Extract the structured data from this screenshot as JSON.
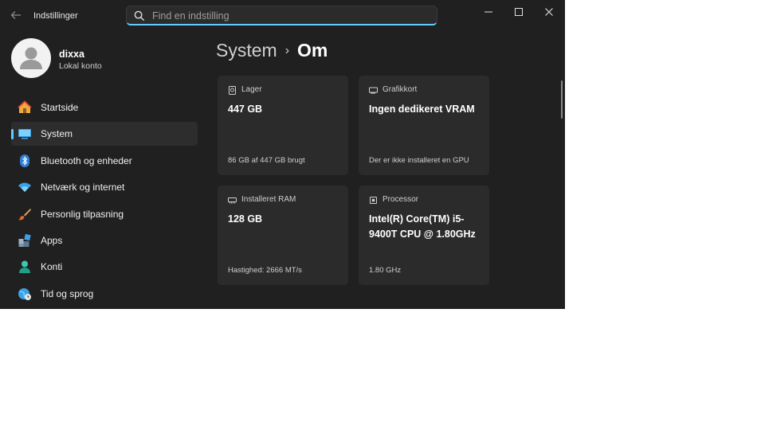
{
  "window": {
    "title": "Indstillinger",
    "search": {
      "placeholder": "Find en indstilling",
      "value": ""
    },
    "controls": {
      "minimize": "minimize",
      "maximize": "maximize",
      "close": "close"
    }
  },
  "profile": {
    "name": "dixxa",
    "account_type": "Lokal konto"
  },
  "sidebar": {
    "items": [
      {
        "label": "Startside",
        "icon": "home-icon"
      },
      {
        "label": "System",
        "icon": "monitor-icon",
        "active": true
      },
      {
        "label": "Bluetooth og enheder",
        "icon": "bluetooth-icon"
      },
      {
        "label": "Netværk og internet",
        "icon": "wifi-icon"
      },
      {
        "label": "Personlig tilpasning",
        "icon": "brush-icon"
      },
      {
        "label": "Apps",
        "icon": "apps-icon"
      },
      {
        "label": "Konti",
        "icon": "person-icon"
      },
      {
        "label": "Tid og sprog",
        "icon": "globe-clock-icon"
      }
    ]
  },
  "breadcrumb": {
    "parent": "System",
    "current": "Om"
  },
  "cards": {
    "storage": {
      "heading": "Lager",
      "value": "447 GB",
      "footer": "86 GB af 447 GB brugt"
    },
    "graphics": {
      "heading": "Grafikkort",
      "value": "Ingen dedikeret VRAM",
      "footer": "Der er ikke installeret en GPU"
    },
    "ram": {
      "heading": "Installeret RAM",
      "value": "128 GB",
      "footer": "Hastighed: 2666 MT/s"
    },
    "processor": {
      "heading": "Processor",
      "value": "Intel(R) Core(TM) i5-9400T CPU @ 1.80GHz",
      "footer": "1.80 GHz"
    }
  },
  "colors": {
    "accent": "#60cdff",
    "window_bg": "#202020",
    "card_bg": "#2b2b2b",
    "active_item_bg": "#2d2d2d"
  }
}
